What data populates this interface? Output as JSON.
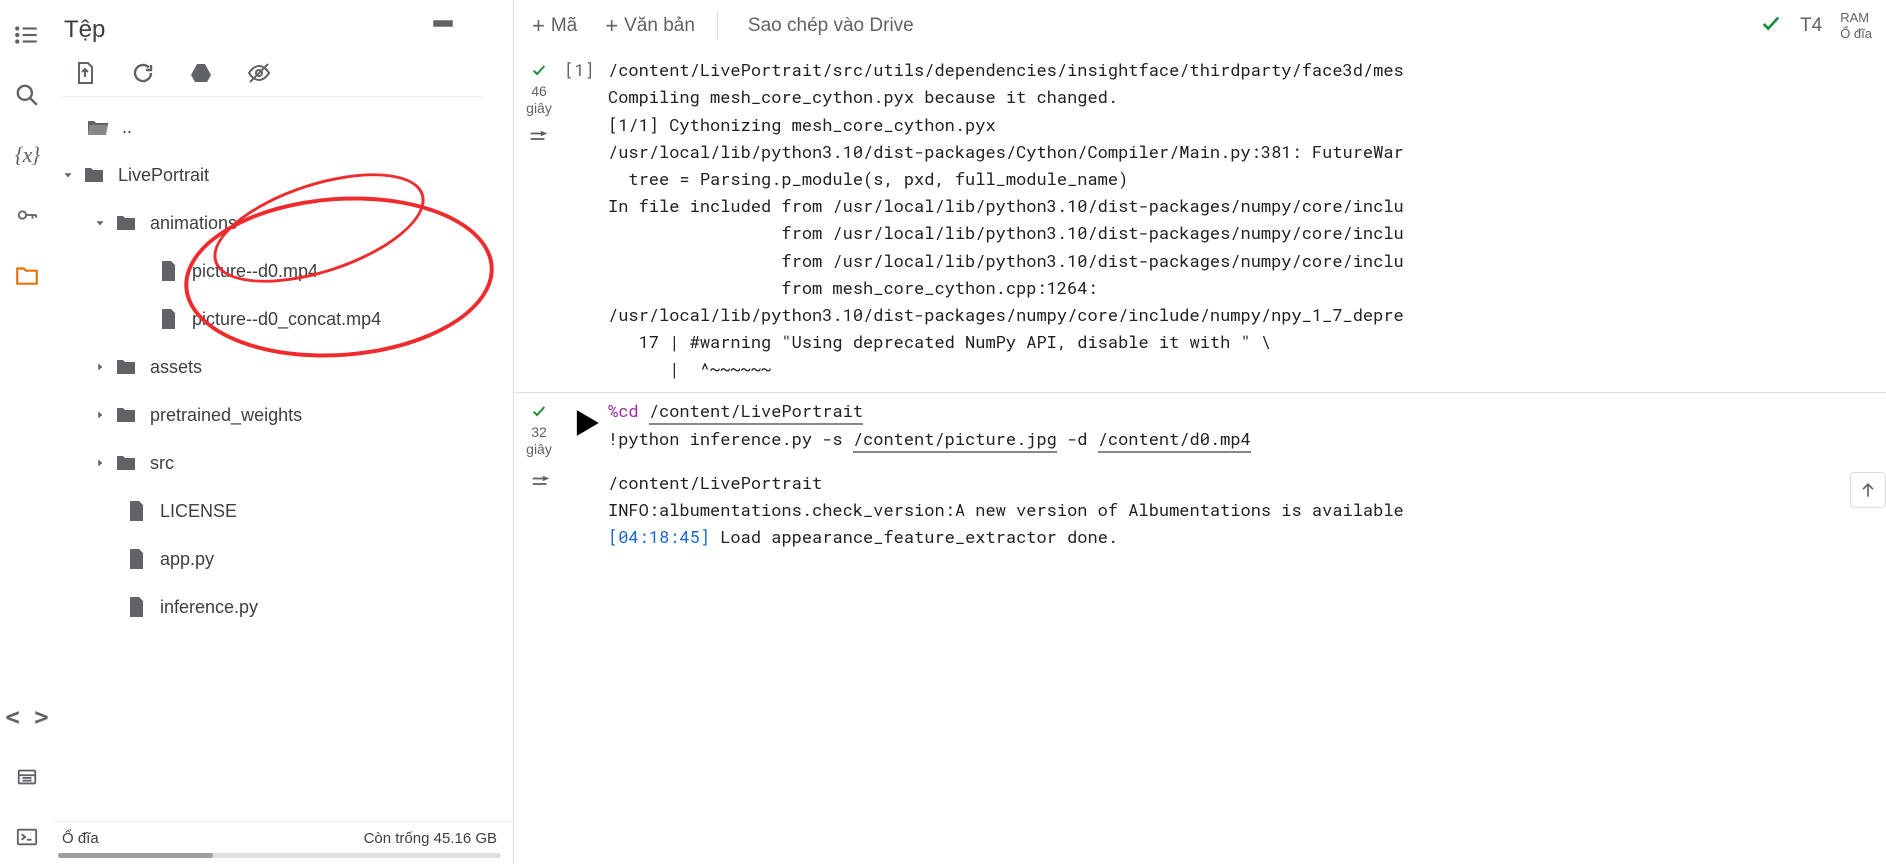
{
  "rail": {
    "toc": "table-of-contents",
    "search": "search",
    "vars": "variables",
    "key": "secrets",
    "folder": "files",
    "code": "code-snippets",
    "terminal": "terminal",
    "scratch": "scratchpad"
  },
  "files": {
    "title": "Tệp",
    "footer_label": "Ổ đĩa",
    "footer_free": "Còn trống 45.16 GB",
    "tree": {
      "up": "..",
      "root": "LivePortrait",
      "anim": "animations",
      "f1": "picture--d0.mp4",
      "f2": "picture--d0_concat.mp4",
      "assets": "assets",
      "pretrained": "pretrained_weights",
      "src": "src",
      "license": "LICENSE",
      "app": "app.py",
      "inference": "inference.py"
    }
  },
  "topbar": {
    "code": "Mã",
    "text": "Văn bản",
    "drive": "Sao chép vào Drive",
    "runtime": "T4",
    "ram": "RAM",
    "disk": "Ổ đĩa"
  },
  "cell1": {
    "gutter_time": "46",
    "gutter_unit": "giây",
    "prompt": "[1]",
    "out_lines": [
      "/content/LivePortrait/src/utils/dependencies/insightface/thirdparty/face3d/mes",
      "Compiling mesh_core_cython.pyx because it changed.",
      "[1/1] Cythonizing mesh_core_cython.pyx",
      "/usr/local/lib/python3.10/dist-packages/Cython/Compiler/Main.py:381: FutureWar",
      "  tree = Parsing.p_module(s, pxd, full_module_name)",
      "In file included from /usr/local/lib/python3.10/dist-packages/numpy/core/inclu",
      "                 from /usr/local/lib/python3.10/dist-packages/numpy/core/inclu",
      "                 from /usr/local/lib/python3.10/dist-packages/numpy/core/inclu",
      "                 from mesh_core_cython.cpp:1264:",
      "/usr/local/lib/python3.10/dist-packages/numpy/core/include/numpy/npy_1_7_depre",
      "   17 | #warning \"Using deprecated NumPy API, disable it with \" \\",
      "      |  ^~~~~~~"
    ]
  },
  "cell2": {
    "gutter_time": "32",
    "gutter_unit": "giây",
    "magic": "%cd",
    "cd_path": "/content/LivePortrait",
    "bang_line_pre": "!python inference.py -s ",
    "bang_arg1": "/content/picture.jpg",
    "bang_mid": " -d ",
    "bang_arg2": "/content/d0.mp4",
    "out_l1": "/content/LivePortrait",
    "out_l2": "INFO:albumentations.check_version:A new version of Albumentations is available",
    "out_ts": "[04:18:45]",
    "out_l3": " Load appearance_feature_extractor done."
  }
}
